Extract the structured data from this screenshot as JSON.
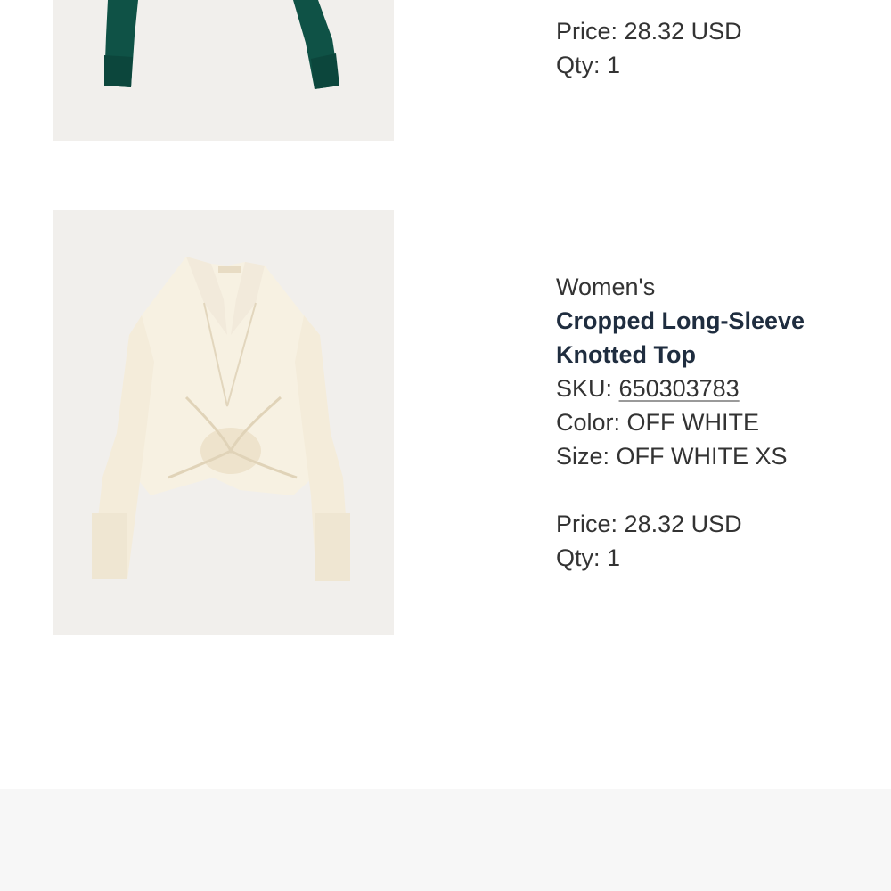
{
  "orders": [
    {
      "image_alt": "green long-sleeve top",
      "price_label": "Price:",
      "price": "28.32 USD",
      "qty_label": "Qty:",
      "qty": "1"
    },
    {
      "image_alt": "off white cropped knotted top",
      "category": "Women's",
      "name": "Cropped Long-Sleeve Knotted Top",
      "sku_label": "SKU:",
      "sku": "650303783",
      "color_label": "Color:",
      "color": "OFF WHITE",
      "size_label": "Size:",
      "size": "OFF WHITE XS",
      "price_label": "Price:",
      "price": "28.32 USD",
      "qty_label": "Qty:",
      "qty": "1"
    }
  ],
  "colors": {
    "image_background": "#f1efec",
    "heading": "#1f2d3f",
    "text": "#333333",
    "footer_background": "#f7f7f7",
    "garment_green": "#0f5246",
    "garment_cream": "#f7f1e2"
  }
}
